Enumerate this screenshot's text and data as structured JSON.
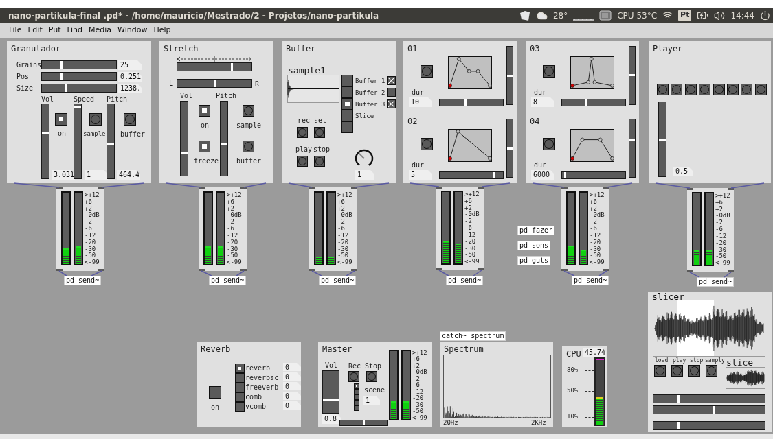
{
  "window": {
    "title": "nano-partikula-final .pd* - /home/mauricio/Mestrado/2 - Projetos/nano-partikula"
  },
  "tray": {
    "weather": "28°",
    "cpu": "CPU 53°C",
    "keyboard": "Pt",
    "time": "14:44"
  },
  "menu": [
    "File",
    "Edit",
    "Put",
    "Find",
    "Media",
    "Window",
    "Help"
  ],
  "granulador": {
    "title": "Granulador",
    "sliders": [
      {
        "label": "Grains",
        "level": 0.26,
        "value": "25"
      },
      {
        "label": "Pos",
        "level": 0.26,
        "value": "0.251"
      },
      {
        "label": "Size",
        "level": 0.32,
        "value": "1238."
      }
    ],
    "faders": [
      {
        "label": "Vol",
        "level": 0.61,
        "value": "3.031"
      },
      {
        "label": "Speed",
        "level": 0.98,
        "value": "1"
      },
      {
        "label": "Pitch",
        "level": 0.47,
        "value": "464.4"
      }
    ],
    "toggle": {
      "label": "on",
      "checked": true
    },
    "bangs": [
      "sample",
      "buffer"
    ]
  },
  "stretch": {
    "title": "Stretch",
    "speed": {
      "level": 0.74
    },
    "pan": {
      "left": "L",
      "right": "R",
      "level": 0.5
    },
    "faders": [
      {
        "label": "Vol",
        "level": 0.3
      },
      {
        "label": "Pitch",
        "level": 0.43
      }
    ],
    "toggles": [
      {
        "label": "on",
        "checked": true
      },
      {
        "label": "freeze",
        "checked": true
      }
    ],
    "bangs": [
      "sample",
      "buffer"
    ]
  },
  "buffer": {
    "title": "Buffer",
    "array": "sample1",
    "radio": [
      {
        "label": "Buffer 1",
        "selected": false,
        "checked": true
      },
      {
        "label": "Buffer 2",
        "selected": false,
        "checked": false
      },
      {
        "label": "Buffer 3",
        "selected": true,
        "checked": true
      },
      {
        "label": "Slice",
        "selected": false
      },
      {
        "selected": false
      }
    ],
    "bangs": [
      "rec",
      "set",
      "play",
      "stop"
    ],
    "knob": {
      "value": "1"
    }
  },
  "envelopes": [
    {
      "title": "01",
      "dur_label": "dur",
      "dur": "10",
      "fader": {
        "level": 0.5
      },
      "slider": {
        "level": 0.41
      }
    },
    {
      "title": "02",
      "dur_label": "dur",
      "dur": "5",
      "fader": {
        "level": 0.5
      },
      "slider": {
        "level": 0.87
      }
    },
    {
      "title": "03",
      "dur_label": "dur",
      "dur": "8",
      "fader": {
        "level": 0.51
      },
      "slider": {
        "level": 0.37
      }
    },
    {
      "title": "04",
      "dur_label": "dur",
      "dur": "6000",
      "fader": {
        "level": 0.66
      },
      "slider": {
        "level": 0.03
      }
    }
  ],
  "player": {
    "title": "Player",
    "fader": {
      "level": 0.5
    },
    "value": "0.5"
  },
  "meters": [
    {
      "left": {
        "level": 0.22
      },
      "right": {
        "level": 0.25
      },
      "scale": [
        ">+12",
        "+6",
        "+2",
        "-0dB",
        "-2",
        "-6",
        "-12",
        "-20",
        "-30",
        "-50",
        "<-99"
      ],
      "send": "pd send~"
    },
    {
      "left": {
        "level": 0.25
      },
      "right": {
        "level": 0.25
      },
      "scale": [
        ">+12",
        "+6",
        "+2",
        "-0dB",
        "-2",
        "-6",
        "-12",
        "-20",
        "-30",
        "-50",
        "<-99"
      ],
      "send": "pd send~"
    },
    {
      "left": {
        "level": 0.11
      },
      "right": {
        "level": 0.11
      },
      "scale": [
        ">+12",
        "+6",
        "+2",
        "-0dB",
        "-2",
        "-6",
        "-12",
        "-20",
        "-30",
        "-50",
        "<-99"
      ],
      "send": "pd send~"
    },
    {
      "left": {
        "level": 0.32
      },
      "right": {
        "level": 0.28
      },
      "scale": [
        ">+12",
        "+6",
        "+2",
        "-0dB",
        "-2",
        "-6",
        "-12",
        "-20",
        "-30",
        "-50",
        "<-99"
      ],
      "send": "pd send~"
    },
    {
      "left": {
        "level": 0.26
      },
      "right": {
        "level": 0.2
      },
      "scale": [
        ">+12",
        "+6",
        "+2",
        "-0dB",
        "-2",
        "-6",
        "-12",
        "-20",
        "-30",
        "-50",
        "<-99"
      ],
      "send": "pd send~"
    },
    {
      "left": {
        "level": 0.2
      },
      "right": {
        "level": 0.2
      },
      "scale": [
        ">+12",
        "+6",
        "+2",
        "-0dB",
        "-2",
        "-6",
        "-12",
        "-20",
        "-30",
        "-50",
        "<-99"
      ],
      "send": "pd send~"
    }
  ],
  "subpatches": [
    "pd fazer",
    "pd sons",
    "pd guts"
  ],
  "reverb": {
    "title": "Reverb",
    "toggle": {
      "label": "on",
      "checked": false
    },
    "options": [
      {
        "label": "reverb",
        "selected": true,
        "value": "0"
      },
      {
        "label": "reverbsc",
        "selected": false,
        "value": "0"
      },
      {
        "label": "freeverb",
        "selected": false,
        "value": "0"
      },
      {
        "label": "comb",
        "selected": false,
        "value": "0"
      },
      {
        "label": "vcomb",
        "selected": false,
        "value": "0"
      }
    ]
  },
  "master": {
    "title": "Master",
    "fader": {
      "label": "Vol",
      "level": 0.29,
      "value": "0.8"
    },
    "bangs": [
      "Rec",
      "Stop"
    ],
    "scene": {
      "label": "scene",
      "value": "1",
      "radio": [
        {
          "selected": true
        },
        {
          "selected": false
        },
        {
          "selected": false
        },
        {
          "selected": false
        },
        {
          "selected": false
        }
      ]
    },
    "slider": {
      "level": 0.5
    },
    "meter": {
      "left": {
        "level": 0.26
      },
      "right": {
        "level": 0.26
      },
      "scale": [
        ">+12",
        "+6",
        "+2",
        "-0dB",
        "-2",
        "-6",
        "-12",
        "-20",
        "-30",
        "-50",
        "<-99"
      ]
    }
  },
  "spectrum": {
    "object": "catch~ spectrum",
    "title": "Spectrum",
    "x_start": "20Hz",
    "x_end": "2KHz"
  },
  "cpu": {
    "title": "CPU",
    "value": "45.74",
    "level": 0.42,
    "ticks": [
      "80%",
      "50%",
      "10%"
    ]
  },
  "slicer": {
    "title": "slicer",
    "bangs": [
      "load",
      "play",
      "stop",
      "samply"
    ],
    "slice_title": "slice",
    "sliders": [
      {
        "level": 0.22
      },
      {
        "level": 0.54
      },
      {
        "level": 0.22
      }
    ]
  }
}
